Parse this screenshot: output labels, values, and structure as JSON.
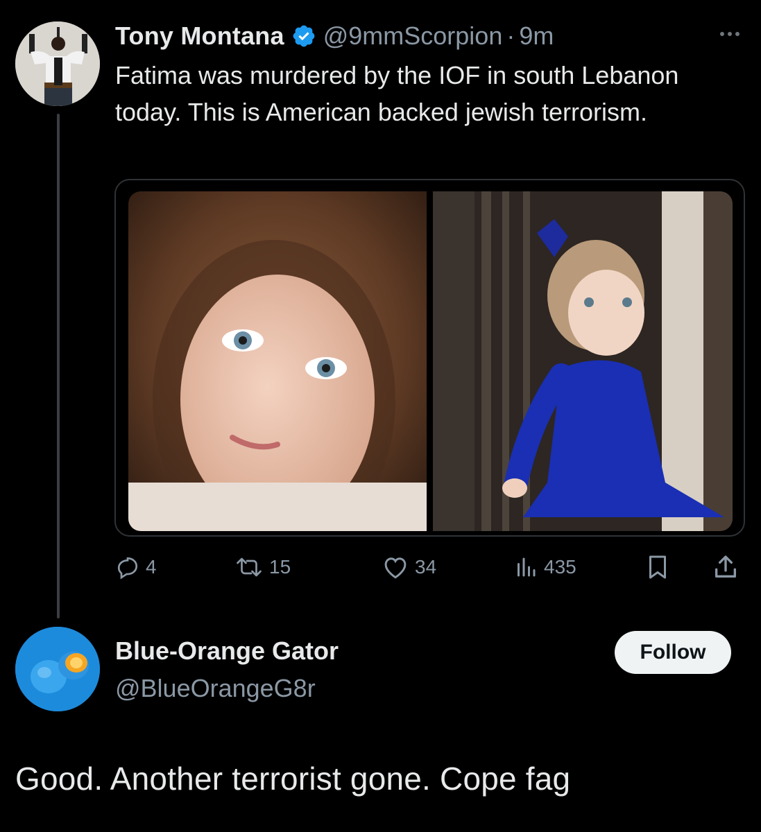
{
  "tweet": {
    "author_name": "Tony Montana",
    "author_handle": "@9mmScorpion",
    "separator": "·",
    "time": "9m",
    "verified": true,
    "text": "Fatima was murdered by the IOF in south Lebanon today. This is American backed jewish terrorism.",
    "media": [
      {
        "icon": "photo-close-up-portrait"
      },
      {
        "icon": "photo-girl-in-blue-dress"
      }
    ],
    "metrics": {
      "replies": "4",
      "reposts": "15",
      "likes": "34",
      "views": "435"
    }
  },
  "reply": {
    "author_name": "Blue-Orange Gator",
    "author_handle": "@BlueOrangeG8r",
    "follow_label": "Follow",
    "text": "Good. Another terrorist gone. Cope fag"
  },
  "colors": {
    "background": "#000000",
    "primary_text": "#e7e9ea",
    "secondary_text": "#8b98a5",
    "verified_blue": "#1d9bf0",
    "follow_button_bg": "#eff3f4"
  }
}
